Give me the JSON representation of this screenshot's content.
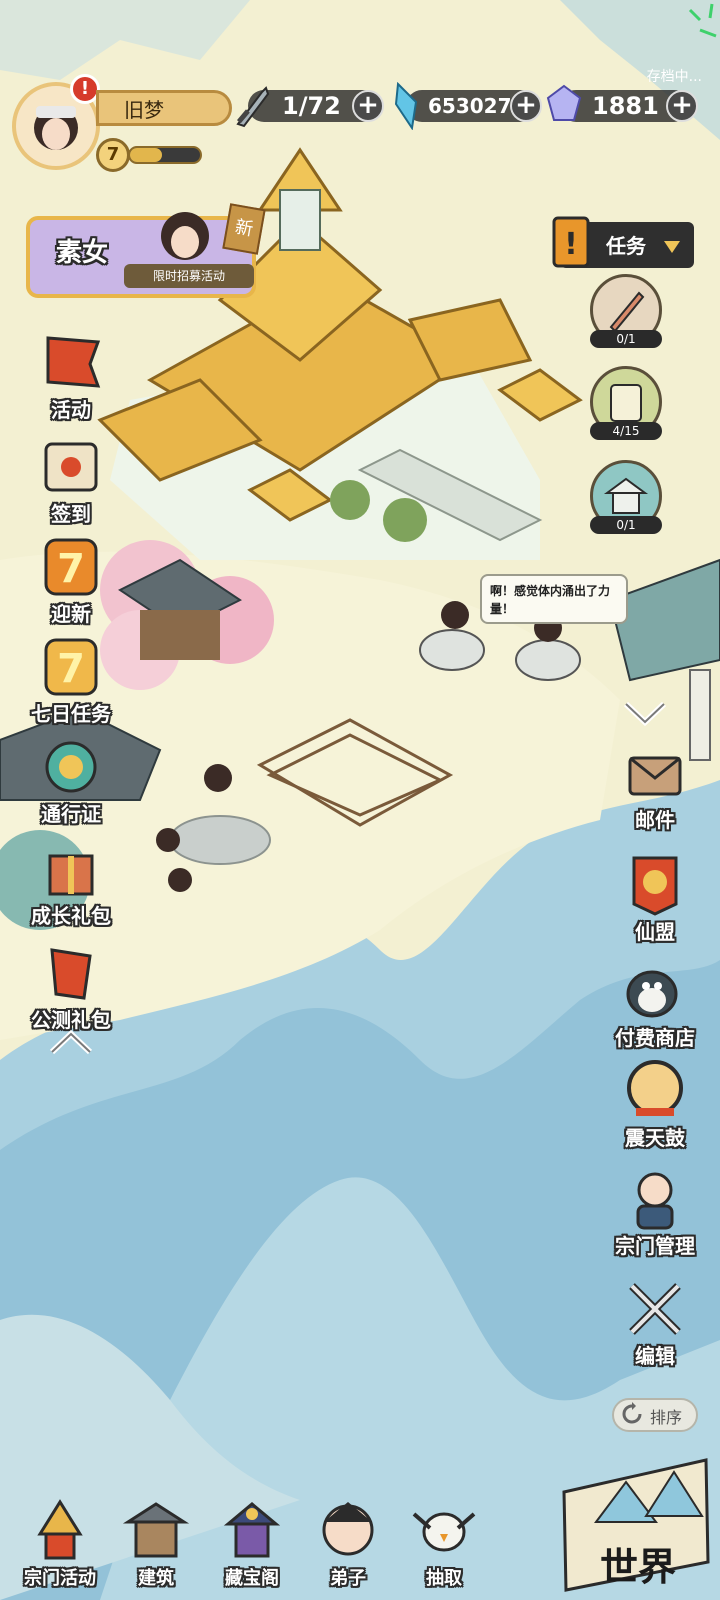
{
  "player": {
    "name": "旧梦",
    "level": "7",
    "alert": "!",
    "xp_progress": 0.45
  },
  "resources": {
    "stamina": "1/72",
    "jade": "653027",
    "crystal": "1881"
  },
  "save_status": "存档中...",
  "banner": {
    "title": "素女",
    "subtitle": "限时招募活动",
    "new_tag": "新"
  },
  "left_menu": [
    {
      "label": "活动",
      "icon": "banner-flag-icon"
    },
    {
      "label": "签到",
      "icon": "scroll-icon"
    },
    {
      "label": "迎新",
      "icon": "seven-badge-icon"
    },
    {
      "label": "七日任务",
      "icon": "seven-day-icon"
    },
    {
      "label": "通行证",
      "icon": "pass-medal-icon"
    },
    {
      "label": "成长礼包",
      "icon": "gift-box-icon"
    },
    {
      "label": "公测礼包",
      "icon": "lantern-icon"
    }
  ],
  "task": {
    "label": "任务"
  },
  "quests": [
    {
      "count": "0/1",
      "icon": "sword-icon"
    },
    {
      "count": "4/15",
      "icon": "scroll-quest-icon"
    },
    {
      "count": "0/1",
      "icon": "pavilion-icon"
    }
  ],
  "speech": "啊！感觉体内涌出了力量！",
  "right_menu": [
    {
      "label": "邮件",
      "icon": "mail-icon"
    },
    {
      "label": "仙盟",
      "icon": "alliance-flag-icon"
    },
    {
      "label": "付费商店",
      "icon": "shop-penguin-icon"
    },
    {
      "label": "震天鼓",
      "icon": "drum-icon"
    },
    {
      "label": "宗门管理",
      "icon": "manager-icon"
    },
    {
      "label": "编辑",
      "icon": "edit-arrows-icon"
    }
  ],
  "sort_label": "排序",
  "bottom_nav": [
    {
      "label": "宗门活动",
      "icon": "sect-tower-icon"
    },
    {
      "label": "建筑",
      "icon": "building-icon"
    },
    {
      "label": "藏宝阁",
      "icon": "treasure-pavilion-icon"
    },
    {
      "label": "弟子",
      "icon": "disciple-icon"
    },
    {
      "label": "抽取",
      "icon": "bird-icon"
    }
  ],
  "world_label": "世界",
  "colors": {
    "parchment": "#f3f0d2",
    "mountain": "#9ccbe0",
    "gold": "#e8b64a",
    "dark": "#2b2b2b"
  }
}
